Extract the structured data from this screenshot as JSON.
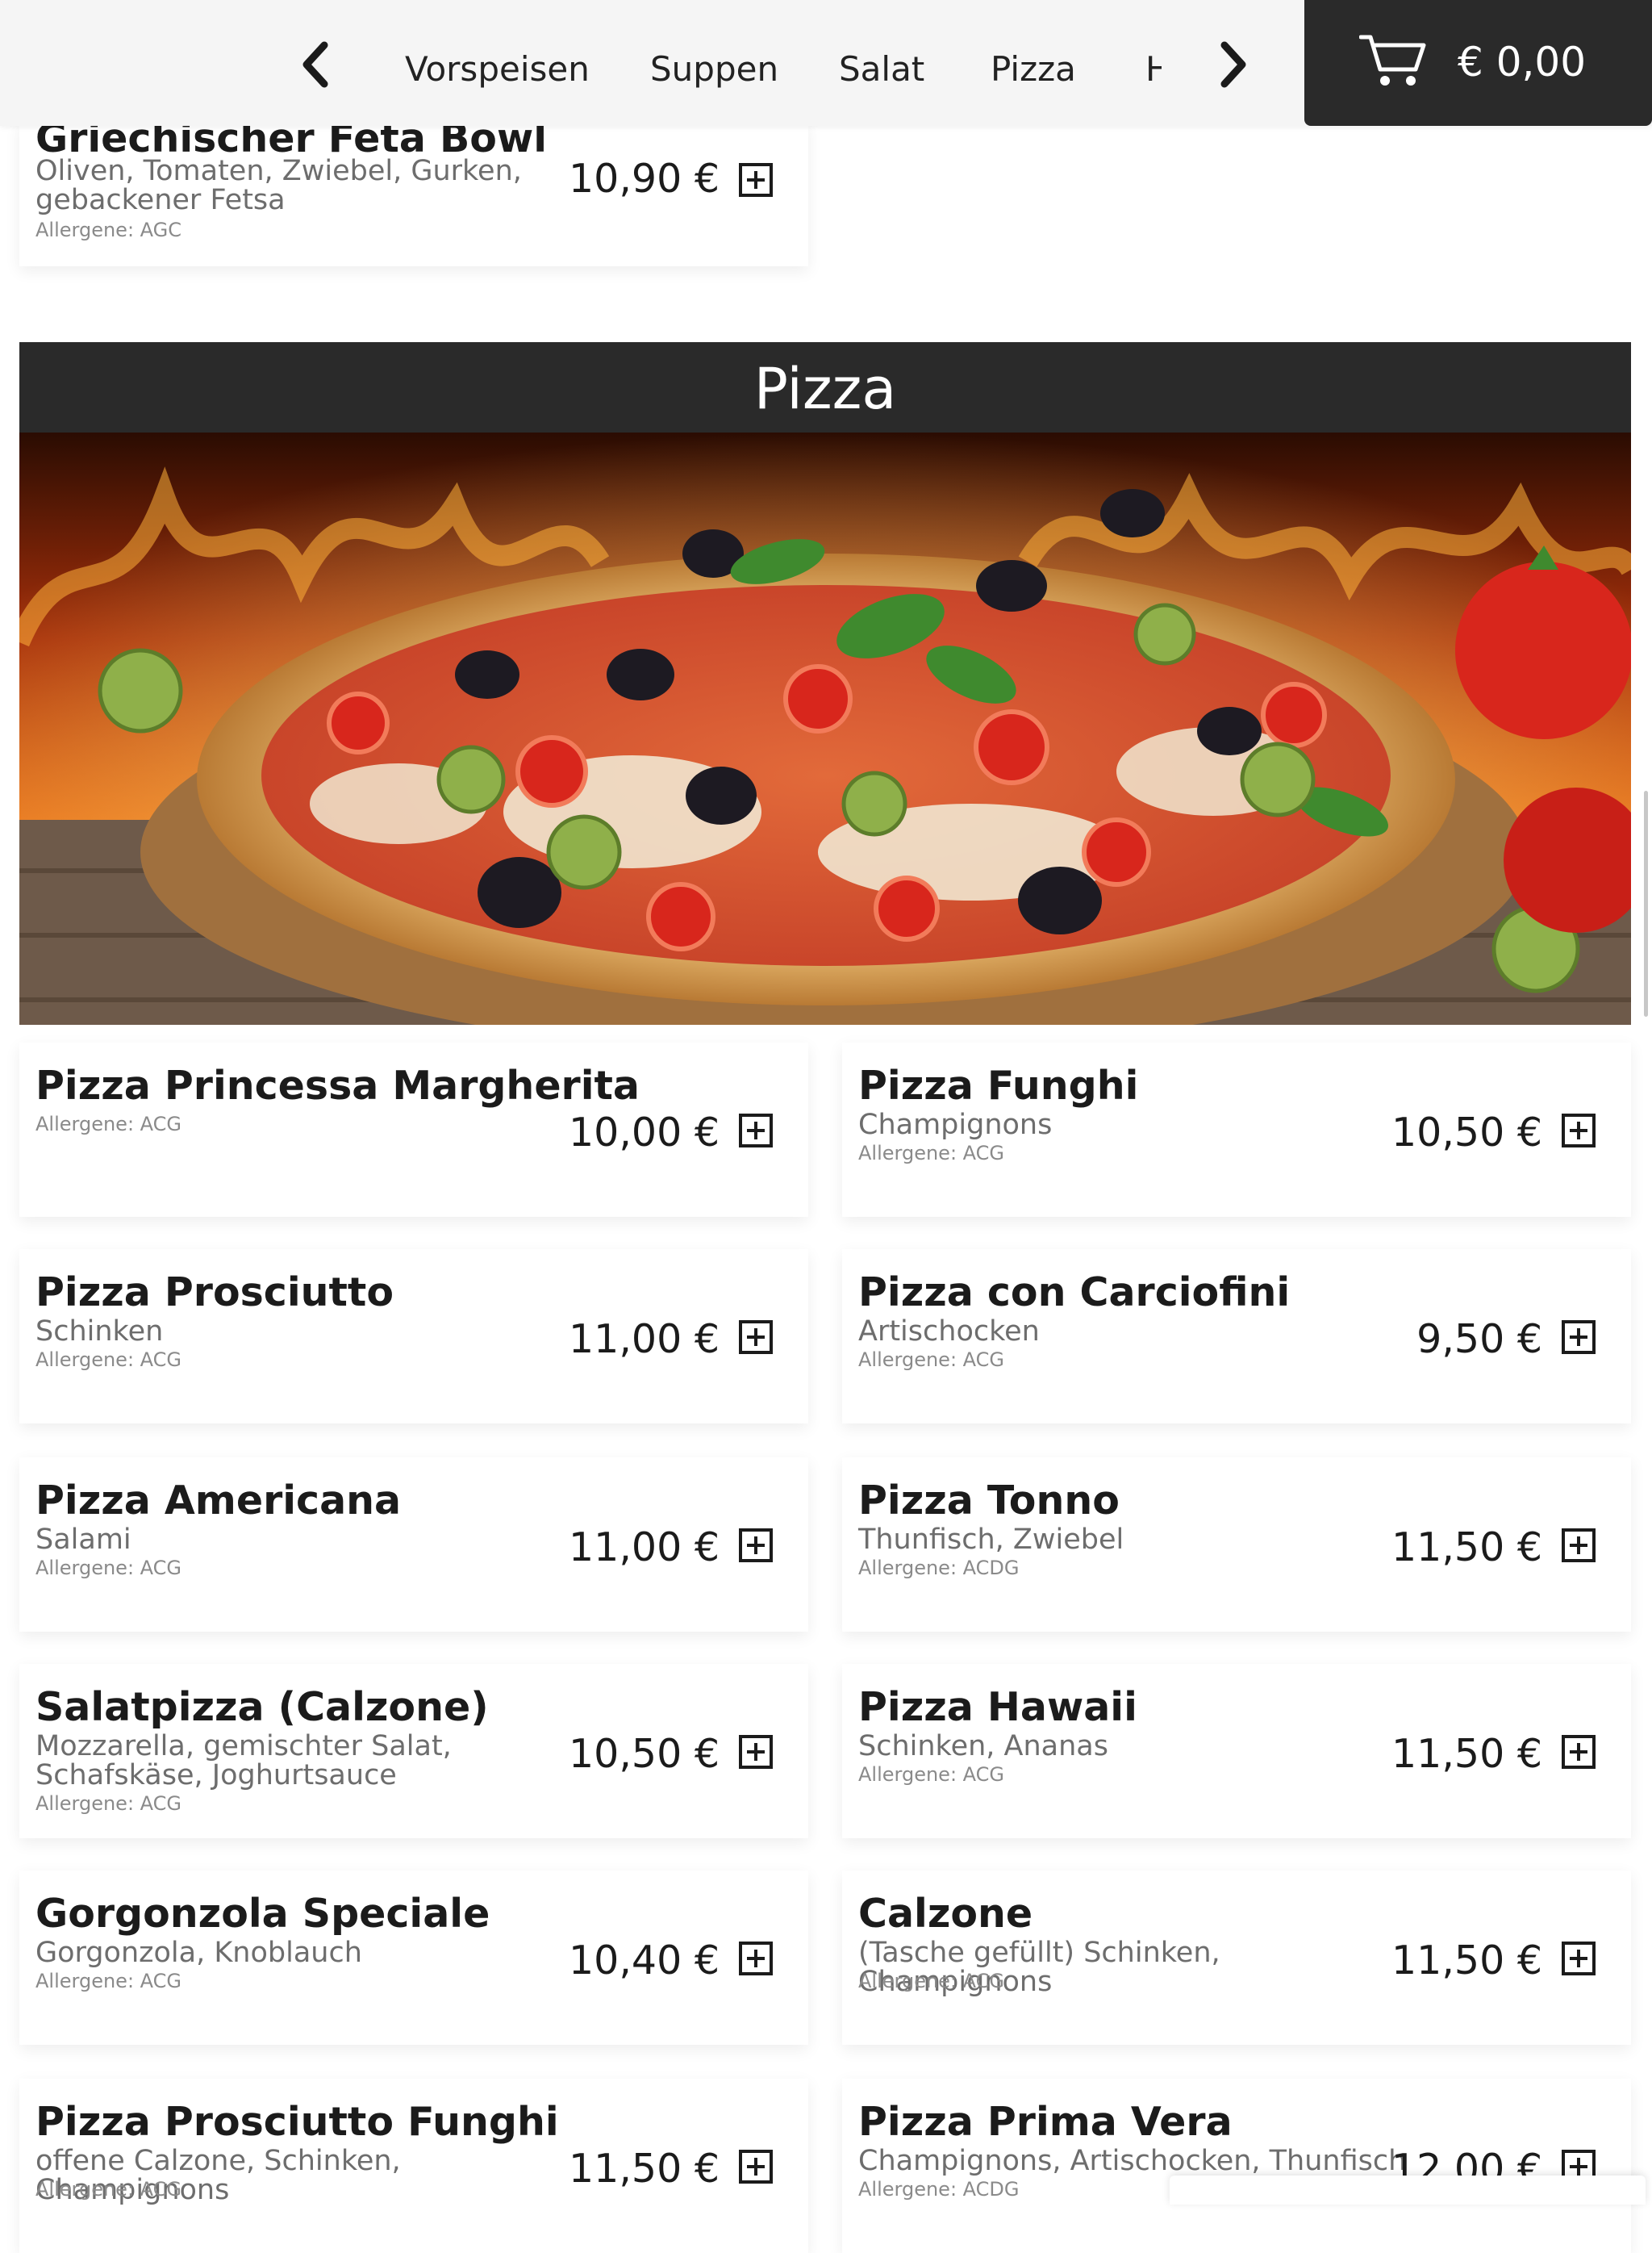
{
  "nav": {
    "categories": [
      "Vorspeisen",
      "Suppen",
      "Salat",
      "Pizza",
      "H"
    ]
  },
  "cart": {
    "total": "€ 0,00"
  },
  "top_item": {
    "title": "Griechischer Feta Bowl",
    "description": "Oliven, Tomaten, Zwiebel, Gurken, gebackener Fetsa",
    "allergens": "Allergene: AGC",
    "price": "10,90 €"
  },
  "section": {
    "title": "Pizza"
  },
  "menu_items": [
    {
      "title": "Pizza Princessa Margherita",
      "description": "",
      "allergens": "Allergene: ACG",
      "price": "10,00 €"
    },
    {
      "title": "Pizza Funghi",
      "description": "Champignons",
      "allergens": "Allergene: ACG",
      "price": "10,50 €"
    },
    {
      "title": "Pizza Prosciutto",
      "description": "Schinken",
      "allergens": "Allergene: ACG",
      "price": "11,00 €"
    },
    {
      "title": "Pizza con Carciofini",
      "description": "Artischocken",
      "allergens": "Allergene: ACG",
      "price": "9,50 €"
    },
    {
      "title": "Pizza Americana",
      "description": "Salami",
      "allergens": "Allergene: ACG",
      "price": "11,00 €"
    },
    {
      "title": "Pizza Tonno",
      "description": "Thunfisch, Zwiebel",
      "allergens": "Allergene: ACDG",
      "price": "11,50 €"
    },
    {
      "title": "Salatpizza (Calzone)",
      "description": "Mozzarella, gemischter Salat, Schafskäse, Joghurtsauce",
      "allergens": "Allergene: ACG",
      "price": "10,50 €"
    },
    {
      "title": "Pizza Hawaii",
      "description": "Schinken, Ananas",
      "allergens": "Allergene: ACG",
      "price": "11,50 €"
    },
    {
      "title": "Gorgonzola Speciale",
      "description": "Gorgonzola, Knoblauch",
      "allergens": "Allergene: ACG",
      "price": "10,40 €"
    },
    {
      "title": "Calzone",
      "description": "(Tasche gefüllt) Schinken, Champignons",
      "allergens": "Allergene: ACG",
      "price": "11,50 €"
    },
    {
      "title": "Pizza Prosciutto Funghi",
      "description": "offene Calzone, Schinken, Champignons",
      "allergens": "Allergene: ACG",
      "price": "11,50 €"
    },
    {
      "title": "Pizza Prima Vera",
      "description": "Champignons, Artischocken, Thunfisch",
      "allergens": "Allergene: ACDG",
      "price": "12,00 €"
    }
  ],
  "icons": {
    "prev": "chevron-left-icon",
    "next": "chevron-right-icon",
    "cart": "cart-icon",
    "add": "plus-square-icon"
  }
}
